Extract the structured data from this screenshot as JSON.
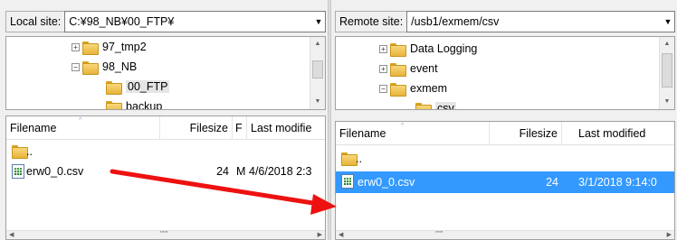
{
  "local": {
    "site_label": "Local site:",
    "path": "C:¥98_NB¥00_FTP¥",
    "tree": [
      {
        "label": "97_tmp2",
        "expander": "+"
      },
      {
        "label": "98_NB",
        "expander": "−"
      },
      {
        "label": "00_FTP",
        "expander": ""
      },
      {
        "label": "backup",
        "expander": ""
      }
    ],
    "columns": {
      "filename": "Filename",
      "filesize": "Filesize",
      "type": "F",
      "modified": "Last modifie"
    },
    "rows": [
      {
        "name": "..",
        "size": "",
        "type": "",
        "modified": ""
      },
      {
        "name": "erw0_0.csv",
        "size": "24",
        "type": "M",
        "modified": "4/6/2018 2:3"
      }
    ]
  },
  "remote": {
    "site_label": "Remote site:",
    "path": "/usb1/exmem/csv",
    "tree": [
      {
        "label": "Data Logging",
        "expander": "+"
      },
      {
        "label": "event",
        "expander": "+"
      },
      {
        "label": "exmem",
        "expander": "−"
      },
      {
        "label": "csv",
        "expander": ""
      }
    ],
    "columns": {
      "filename": "Filename",
      "filesize": "Filesize",
      "modified": "Last modified"
    },
    "rows": [
      {
        "name": "..",
        "size": "",
        "modified": ""
      },
      {
        "name": "erw0_0.csv",
        "size": "24",
        "modified": "3/1/2018 9:14:0"
      }
    ]
  },
  "scroll_grip": "\"\"\"",
  "colors": {
    "selection": "#3399ff",
    "arrow": "#ee1111",
    "folder": "#e7b43b"
  }
}
